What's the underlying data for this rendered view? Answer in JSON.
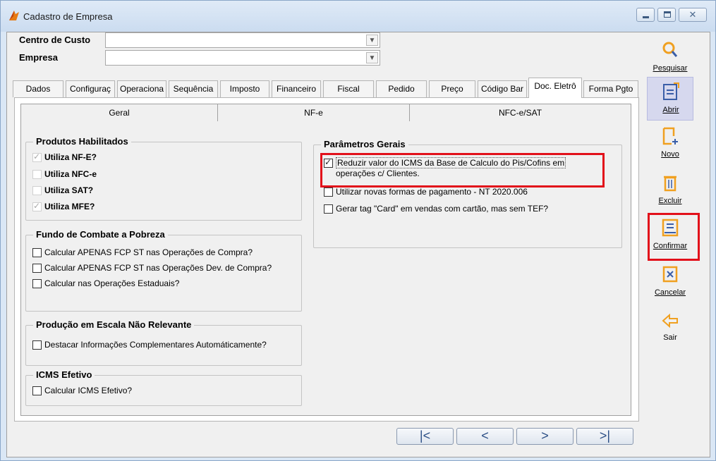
{
  "window": {
    "title": "Cadastro de Empresa"
  },
  "header": {
    "centro_de_custo": {
      "label": "Centro de Custo",
      "value": ""
    },
    "empresa": {
      "label": "Empresa",
      "value": ""
    }
  },
  "tabs": [
    {
      "label": "Dados"
    },
    {
      "label": "Configuraç"
    },
    {
      "label": "Operaciona"
    },
    {
      "label": "Sequência"
    },
    {
      "label": "Imposto"
    },
    {
      "label": "Financeiro"
    },
    {
      "label": "Fiscal"
    },
    {
      "label": "Pedido"
    },
    {
      "label": "Preço"
    },
    {
      "label": "Código Bar"
    },
    {
      "label": "Doc. Eletrô"
    },
    {
      "label": "Forma Pgto"
    }
  ],
  "active_tab": "Doc. Eletrô",
  "subtabs": [
    {
      "label": "Geral"
    },
    {
      "label": "NF-e"
    },
    {
      "label": "NFC-e/SAT"
    }
  ],
  "active_subtab": "Geral",
  "produtos_habilitados": {
    "title": "Produtos Habilitados",
    "items": [
      {
        "label": "Utiliza NF-E?",
        "checked": true
      },
      {
        "label": "Utiliza NFC-e",
        "checked": false
      },
      {
        "label": "Utiliza SAT?",
        "checked": false
      },
      {
        "label": "Utiliza MFE?",
        "checked": true
      }
    ]
  },
  "fundo_combate": {
    "title": "Fundo de Combate a Pobreza",
    "items": [
      {
        "label": "Calcular APENAS FCP ST nas Operações de Compra?",
        "checked": false
      },
      {
        "label": "Calcular APENAS FCP ST nas Operações Dev. de Compra?",
        "checked": false
      },
      {
        "label": "Calcular nas Operações Estaduais?",
        "checked": false
      }
    ]
  },
  "producao_escala": {
    "title": "Produção em Escala Não Relevante",
    "items": [
      {
        "label": "Destacar Informações Complementares Automáticamente?",
        "checked": false
      }
    ]
  },
  "icms_efetivo": {
    "title": "ICMS Efetivo",
    "items": [
      {
        "label": "Calcular ICMS Efetivo?",
        "checked": false
      }
    ]
  },
  "parametros_gerais": {
    "title": "Parâmetros Gerais",
    "items": [
      {
        "label_line1": "Reduzir valor do ICMS da Base de Calculo do Pis/Cofins em",
        "label_line2": "operações c/ Clientes.",
        "checked": true
      },
      {
        "label": "Utilizar novas formas de pagamento - NT 2020.006",
        "checked": false
      },
      {
        "label": "Gerar tag \"Card\" em vendas com cartão, mas sem TEF?",
        "checked": false
      }
    ]
  },
  "navigation": {
    "first": "|<",
    "prev": "<",
    "next": ">",
    "last": ">|"
  },
  "sidebar": {
    "pesquisar": "Pesquisar",
    "abrir": "Abrir",
    "novo": "Novo",
    "excluir": "Excluir",
    "confirmar": "Confirmar",
    "cancelar": "Cancelar",
    "sair": "Sair"
  },
  "colors": {
    "highlight": "#e2101a",
    "icon_orange": "#f0a020",
    "icon_blue": "#3a5ea8"
  }
}
